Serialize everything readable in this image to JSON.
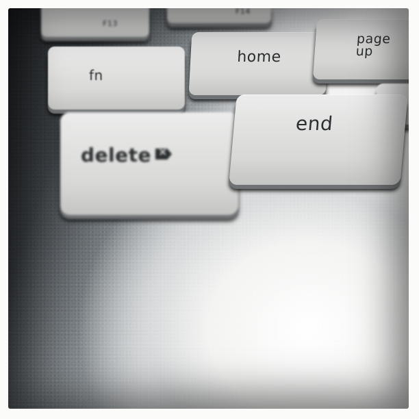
{
  "keys": {
    "f13": "F13",
    "f14": "F14",
    "fn": "fn",
    "home": "home",
    "page_up_line1": "page",
    "page_up_line2": "up",
    "delete": "delete",
    "end": "end"
  },
  "icons": {
    "delete_glyph": "delete-forward-icon"
  }
}
